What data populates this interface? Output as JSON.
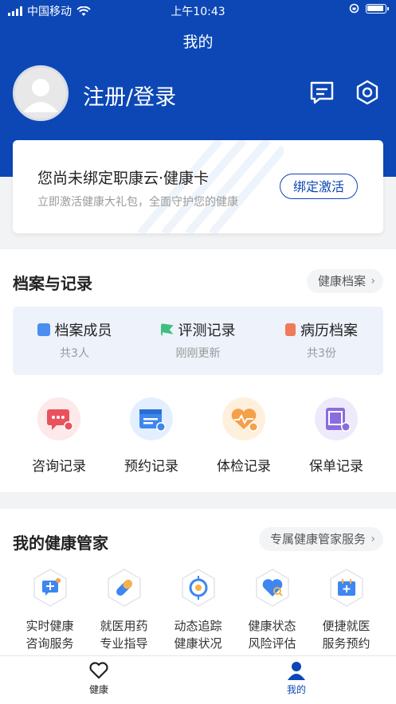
{
  "status_bar": {
    "carrier": "中国移动",
    "time": "上午10:43"
  },
  "header": {
    "title": "我的",
    "login_text": "注册/登录"
  },
  "bind_card": {
    "title": "您尚未绑定职康云·健康卡",
    "subtitle": "立即激活健康大礼包，全面守护您的健康",
    "button": "绑定激活"
  },
  "records_section": {
    "title": "档案与记录",
    "link": "健康档案",
    "summary": [
      {
        "name": "档案成员",
        "value": "共3人",
        "color": "#4a8ef0"
      },
      {
        "name": "评测记录",
        "value": "刚刚更新",
        "color": "#3fbf7f"
      },
      {
        "name": "病历档案",
        "value": "共3份",
        "color": "#f07a5a"
      }
    ],
    "quick": [
      {
        "label": "咨询记录",
        "bg": "#fde8ea",
        "fg": "#e9525d"
      },
      {
        "label": "预约记录",
        "bg": "#e3efff",
        "fg": "#3e86f0"
      },
      {
        "label": "体检记录",
        "bg": "#fff0de",
        "fg": "#f5a04a"
      },
      {
        "label": "保单记录",
        "bg": "#efe9fc",
        "fg": "#8b6be0"
      }
    ]
  },
  "steward_section": {
    "title": "我的健康管家",
    "link": "专属健康管家服务",
    "items": [
      {
        "line1": "实时健康",
        "line2": "咨询服务"
      },
      {
        "line1": "就医用药",
        "line2": "专业指导"
      },
      {
        "line1": "动态追踪",
        "line2": "健康状况"
      },
      {
        "line1": "健康状态",
        "line2": "风险评估"
      },
      {
        "line1": "便捷就医",
        "line2": "服务预约"
      }
    ]
  },
  "tabbar": {
    "health": "健康",
    "mine": "我的"
  }
}
